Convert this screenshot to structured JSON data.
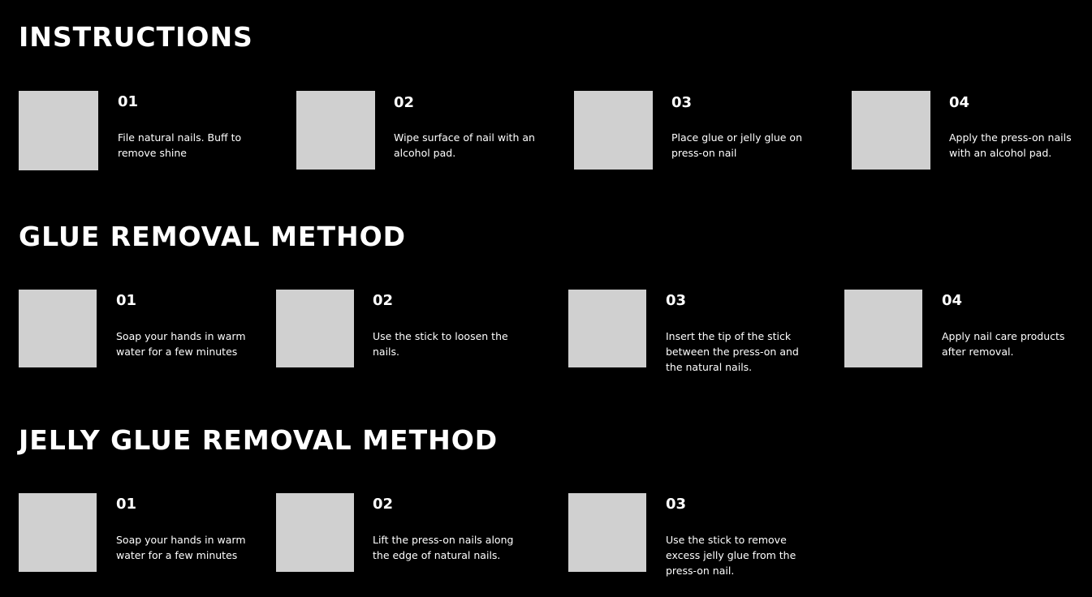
{
  "colors": {
    "background": "#000000",
    "text": "#ffffff",
    "placeholder": "#d0d0d0"
  },
  "sections": [
    {
      "title": "INSTRUCTIONS",
      "steps": [
        {
          "number": "01",
          "text": "File natural nails. Buff to remove shine"
        },
        {
          "number": "02",
          "text": "Wipe surface of nail with an alcohol pad."
        },
        {
          "number": "03",
          "text": "Place glue or jelly glue on press-on nail"
        },
        {
          "number": "04",
          "text": "Apply the press-on nails with an alcohol pad."
        }
      ]
    },
    {
      "title": "GLUE REMOVAL METHOD",
      "steps": [
        {
          "number": "01",
          "text": "Soap your hands in warm water for a few minutes"
        },
        {
          "number": "02",
          "text": "Use the stick to loosen the nails."
        },
        {
          "number": "03",
          "text": "Insert the tip of the stick between the press-on and the natural nails."
        },
        {
          "number": "04",
          "text": "Apply nail care products after removal."
        }
      ]
    },
    {
      "title": "JELLY GLUE REMOVAL METHOD",
      "steps": [
        {
          "number": "01",
          "text": "Soap your hands in warm water for a few minutes"
        },
        {
          "number": "02",
          "text": "Lift the press-on nails along the edge of natural nails."
        },
        {
          "number": "03",
          "text": "Use the stick to remove excess jelly glue from the press-on nail."
        }
      ]
    }
  ]
}
